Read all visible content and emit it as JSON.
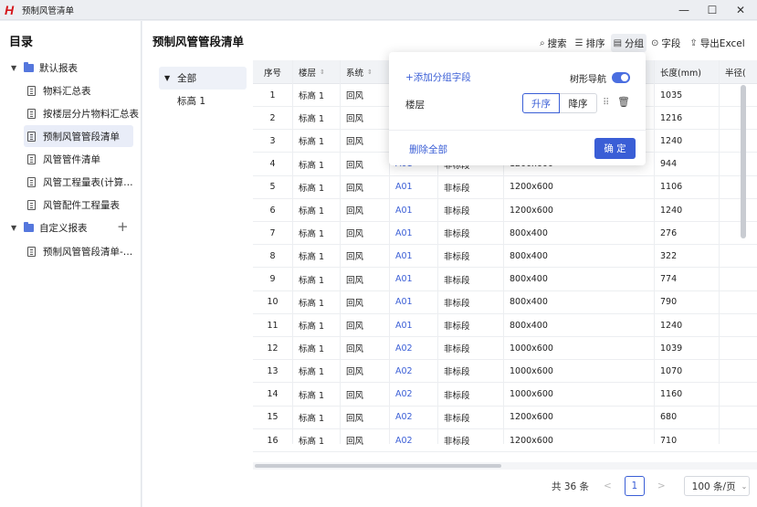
{
  "window": {
    "title": "预制风管清单",
    "minimize": "—",
    "maximize": "☐",
    "close": "✕"
  },
  "sidebar": {
    "title": "目录",
    "groups": [
      {
        "label": "默认报表",
        "items": [
          "物料汇总表",
          "按楼层分片物料汇总表",
          "预制风管管段清单",
          "风管管件清单",
          "风管工程量表(计算…",
          "风管配件工程量表"
        ]
      },
      {
        "label": "自定义报表",
        "items": [
          "预制风管管段清单-…"
        ],
        "add_icon": "+"
      }
    ],
    "active_item": "预制风管管段清单"
  },
  "main": {
    "title": "预制风管管段清单",
    "toolbar": {
      "search": "搜索",
      "sort": "排序",
      "group": "分组",
      "field": "字段",
      "export": "导出Excel"
    },
    "group_tree": {
      "all": "全部",
      "children": [
        "标高 1"
      ]
    },
    "table": {
      "headers": [
        "序号",
        "楼层",
        "系统",
        "",
        "",
        "",
        "长度(mm)",
        "半径("
      ],
      "rows": [
        [
          "1",
          "标高 1",
          "回风",
          "",
          "",
          "",
          "1035"
        ],
        [
          "2",
          "标高 1",
          "回风",
          "",
          "",
          "",
          "1216"
        ],
        [
          "3",
          "标高 1",
          "回风",
          "",
          "",
          "",
          "1240"
        ],
        [
          "4",
          "标高 1",
          "回风",
          "A01",
          "非标段",
          "1200x600",
          "944"
        ],
        [
          "5",
          "标高 1",
          "回风",
          "A01",
          "非标段",
          "1200x600",
          "1106"
        ],
        [
          "6",
          "标高 1",
          "回风",
          "A01",
          "非标段",
          "1200x600",
          "1240"
        ],
        [
          "7",
          "标高 1",
          "回风",
          "A01",
          "非标段",
          "800x400",
          "276"
        ],
        [
          "8",
          "标高 1",
          "回风",
          "A01",
          "非标段",
          "800x400",
          "322"
        ],
        [
          "9",
          "标高 1",
          "回风",
          "A01",
          "非标段",
          "800x400",
          "774"
        ],
        [
          "10",
          "标高 1",
          "回风",
          "A01",
          "非标段",
          "800x400",
          "790"
        ],
        [
          "11",
          "标高 1",
          "回风",
          "A01",
          "非标段",
          "800x400",
          "1240"
        ],
        [
          "12",
          "标高 1",
          "回风",
          "A02",
          "非标段",
          "1000x600",
          "1039"
        ],
        [
          "13",
          "标高 1",
          "回风",
          "A02",
          "非标段",
          "1000x600",
          "1070"
        ],
        [
          "14",
          "标高 1",
          "回风",
          "A02",
          "非标段",
          "1000x600",
          "1160"
        ],
        [
          "15",
          "标高 1",
          "回风",
          "A02",
          "非标段",
          "1200x600",
          "680"
        ],
        [
          "16",
          "标高 1",
          "回风",
          "A02",
          "非标段",
          "1200x600",
          "710"
        ]
      ]
    },
    "pager": {
      "total": "共 36 条",
      "prev": "<",
      "page": "1",
      "next": ">",
      "page_size": "100 条/页"
    }
  },
  "group_popup": {
    "add_field": "+添加分组字段",
    "tree_nav": "树形导航",
    "tree_nav_on": true,
    "field": "楼层",
    "asc": "升序",
    "desc": "降序",
    "delete_all": "删除全部",
    "confirm": "确 定"
  },
  "colors": {
    "accent": "#3a5ed6",
    "logo": "#d5161b"
  }
}
